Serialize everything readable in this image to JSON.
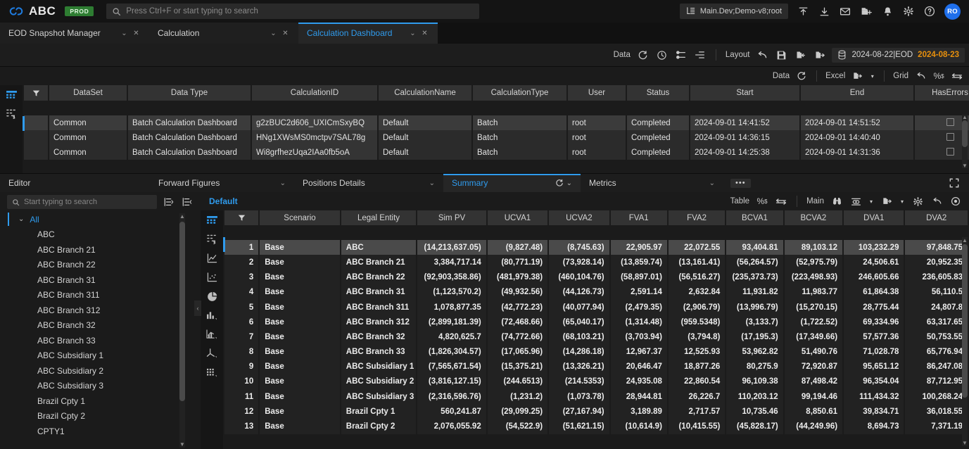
{
  "topbar": {
    "brand": "ABC",
    "env_badge": "PROD",
    "search_placeholder": "Press Ctrl+F or start typing to search",
    "search_value": "",
    "context": "Main.Dev;Demo-v8;root",
    "avatar_initials": "RO",
    "icons": [
      "upload-icon",
      "download-icon",
      "mail-icon",
      "new-folder-icon",
      "bell-icon",
      "gear-icon",
      "help-icon"
    ]
  },
  "tabs": [
    {
      "label": "EOD Snapshot Manager",
      "active": false
    },
    {
      "label": "Calculation",
      "active": false
    },
    {
      "label": "Calculation Dashboard",
      "active": true
    }
  ],
  "actionbar": {
    "data_label": "Data",
    "layout_label": "Layout",
    "snapshot_date": "2024-08-22|EOD",
    "business_date": "2024-08-23",
    "accent_orange": "#e8900c"
  },
  "top_grid": {
    "toolbar": {
      "data_label": "Data",
      "excel_label": "Excel",
      "grid_label": "Grid"
    },
    "columns": [
      "DataSet",
      "Data Type",
      "CalculationID",
      "CalculationName",
      "CalculationType",
      "User",
      "Status",
      "Start",
      "End",
      "HasErrors"
    ],
    "rows": [
      {
        "dataset": "Common",
        "datatype": "Batch Calculation Dashboard",
        "calcid": "g2zBUC2d606_UXICmSxyBQ",
        "calcname": "Default",
        "calctype": "Batch",
        "user": "root",
        "status": "Completed",
        "start": "2024-09-01 14:41:52",
        "end": "2024-09-01 14:51:52",
        "haserrors": ""
      },
      {
        "dataset": "Common",
        "datatype": "Batch Calculation Dashboard",
        "calcid": "HNg1XWsMS0mctpv7SAL78g",
        "calcname": "Default",
        "calctype": "Batch",
        "user": "root",
        "status": "Completed",
        "start": "2024-09-01 14:36:15",
        "end": "2024-09-01 14:40:40",
        "haserrors": ""
      },
      {
        "dataset": "Common",
        "datatype": "Batch Calculation Dashboard",
        "calcid": "Wi8grfhezUqa2IAa0fb5oA",
        "calcname": "Default",
        "calctype": "Batch",
        "user": "root",
        "status": "Completed",
        "start": "2024-09-01 14:25:38",
        "end": "2024-09-01 14:31:36",
        "haserrors": ""
      }
    ]
  },
  "midbar": {
    "editor_label": "Editor",
    "forward_figures": "Forward Figures",
    "positions_details": "Positions Details",
    "summary_tab": "Summary",
    "metrics": "Metrics",
    "more_dots": "•••"
  },
  "left_pane": {
    "search_placeholder": "Start typing to search",
    "search_value": "",
    "root_label": "All",
    "items": [
      "ABC",
      "ABC Branch 21",
      "ABC Branch 22",
      "ABC Branch 31",
      "ABC Branch 311",
      "ABC Branch 312",
      "ABC Branch 32",
      "ABC Branch 33",
      "ABC Subsidiary 1",
      "ABC Subsidiary 2",
      "ABC Subsidiary 3",
      "Brazil Cpty 1",
      "Brazil Cpty 2",
      "CPTY1"
    ]
  },
  "summary_grid": {
    "default_tab": "Default",
    "tools": {
      "table_label": "Table",
      "main_label": "Main"
    },
    "columns": [
      "Scenario",
      "Legal Entity",
      "Sim PV",
      "UCVA1",
      "UCVA2",
      "FVA1",
      "FVA2",
      "BCVA1",
      "BCVA2",
      "DVA1",
      "DVA2"
    ],
    "rows": [
      {
        "n": "1",
        "scenario": "Base",
        "entity": "ABC",
        "simpv": "(14,213,637.05)",
        "ucva1": "(9,827.48)",
        "ucva2": "(8,745.63)",
        "fva1": "22,905.97",
        "fva2": "22,072.55",
        "bcva1": "93,404.81",
        "bcva2": "89,103.12",
        "dva1": "103,232.29",
        "dva2": "97,848.75"
      },
      {
        "n": "2",
        "scenario": "Base",
        "entity": "ABC Branch 21",
        "simpv": "3,384,717.14",
        "ucva1": "(80,771.19)",
        "ucva2": "(73,928.14)",
        "fva1": "(13,859.74)",
        "fva2": "(13,161.41)",
        "bcva1": "(56,264.57)",
        "bcva2": "(52,975.79)",
        "dva1": "24,506.61",
        "dva2": "20,952.35"
      },
      {
        "n": "3",
        "scenario": "Base",
        "entity": "ABC Branch 22",
        "simpv": "(92,903,358.86)",
        "ucva1": "(481,979.38)",
        "ucva2": "(460,104.76)",
        "fva1": "(58,897.01)",
        "fva2": "(56,516.27)",
        "bcva1": "(235,373.73)",
        "bcva2": "(223,498.93)",
        "dva1": "246,605.66",
        "dva2": "236,605.83"
      },
      {
        "n": "4",
        "scenario": "Base",
        "entity": "ABC Branch 31",
        "simpv": "(1,123,570.2)",
        "ucva1": "(49,932.56)",
        "ucva2": "(44,126.73)",
        "fva1": "2,591.14",
        "fva2": "2,632.84",
        "bcva1": "11,931.82",
        "bcva2": "11,983.77",
        "dva1": "61,864.38",
        "dva2": "56,110.5"
      },
      {
        "n": "5",
        "scenario": "Base",
        "entity": "ABC Branch 311",
        "simpv": "1,078,877.35",
        "ucva1": "(42,772.23)",
        "ucva2": "(40,077.94)",
        "fva1": "(2,479.35)",
        "fva2": "(2,906.79)",
        "bcva1": "(13,996.79)",
        "bcva2": "(15,270.15)",
        "dva1": "28,775.44",
        "dva2": "24,807.8"
      },
      {
        "n": "6",
        "scenario": "Base",
        "entity": "ABC Branch 312",
        "simpv": "(2,899,181.39)",
        "ucva1": "(72,468.66)",
        "ucva2": "(65,040.17)",
        "fva1": "(1,314.48)",
        "fva2": "(959.5348)",
        "bcva1": "(3,133.7)",
        "bcva2": "(1,722.52)",
        "dva1": "69,334.96",
        "dva2": "63,317.65"
      },
      {
        "n": "7",
        "scenario": "Base",
        "entity": "ABC Branch 32",
        "simpv": "4,820,625.7",
        "ucva1": "(74,772.66)",
        "ucva2": "(68,103.21)",
        "fva1": "(3,703.94)",
        "fva2": "(3,794.8)",
        "bcva1": "(17,195.3)",
        "bcva2": "(17,349.66)",
        "dva1": "57,577.36",
        "dva2": "50,753.55"
      },
      {
        "n": "8",
        "scenario": "Base",
        "entity": "ABC Branch 33",
        "simpv": "(1,826,304.57)",
        "ucva1": "(17,065.96)",
        "ucva2": "(14,286.18)",
        "fva1": "12,967.37",
        "fva2": "12,525.93",
        "bcva1": "53,962.82",
        "bcva2": "51,490.76",
        "dva1": "71,028.78",
        "dva2": "65,776.94"
      },
      {
        "n": "9",
        "scenario": "Base",
        "entity": "ABC Subsidiary 1",
        "simpv": "(7,565,671.54)",
        "ucva1": "(15,375.21)",
        "ucva2": "(13,326.21)",
        "fva1": "20,646.47",
        "fva2": "18,877.26",
        "bcva1": "80,275.9",
        "bcva2": "72,920.87",
        "dva1": "95,651.12",
        "dva2": "86,247.08"
      },
      {
        "n": "10",
        "scenario": "Base",
        "entity": "ABC Subsidiary 2",
        "simpv": "(3,816,127.15)",
        "ucva1": "(244.6513)",
        "ucva2": "(214.5353)",
        "fva1": "24,935.08",
        "fva2": "22,860.54",
        "bcva1": "96,109.38",
        "bcva2": "87,498.42",
        "dva1": "96,354.04",
        "dva2": "87,712.95"
      },
      {
        "n": "11",
        "scenario": "Base",
        "entity": "ABC Subsidiary 3",
        "simpv": "(2,316,596.76)",
        "ucva1": "(1,231.2)",
        "ucva2": "(1,073.78)",
        "fva1": "28,944.81",
        "fva2": "26,226.7",
        "bcva1": "110,203.12",
        "bcva2": "99,194.46",
        "dva1": "111,434.32",
        "dva2": "100,268.24"
      },
      {
        "n": "12",
        "scenario": "Base",
        "entity": "Brazil Cpty 1",
        "simpv": "560,241.87",
        "ucva1": "(29,099.25)",
        "ucva2": "(27,167.94)",
        "fva1": "3,189.89",
        "fva2": "2,717.57",
        "bcva1": "10,735.46",
        "bcva2": "8,850.61",
        "dva1": "39,834.71",
        "dva2": "36,018.55"
      },
      {
        "n": "13",
        "scenario": "Base",
        "entity": "Brazil Cpty 2",
        "simpv": "2,076,055.92",
        "ucva1": "(54,522.9)",
        "ucva2": "(51,621.15)",
        "fva1": "(10,614.9)",
        "fva2": "(10,415.55)",
        "bcva1": "(45,828.17)",
        "bcva2": "(44,249.96)",
        "dva1": "8,694.73",
        "dva2": "7,371.19"
      }
    ]
  },
  "colors": {
    "accent_blue": "#2f9bed",
    "negative_red": "#e03b33",
    "badge_green": "#2e7d32",
    "orange": "#e8900c"
  }
}
